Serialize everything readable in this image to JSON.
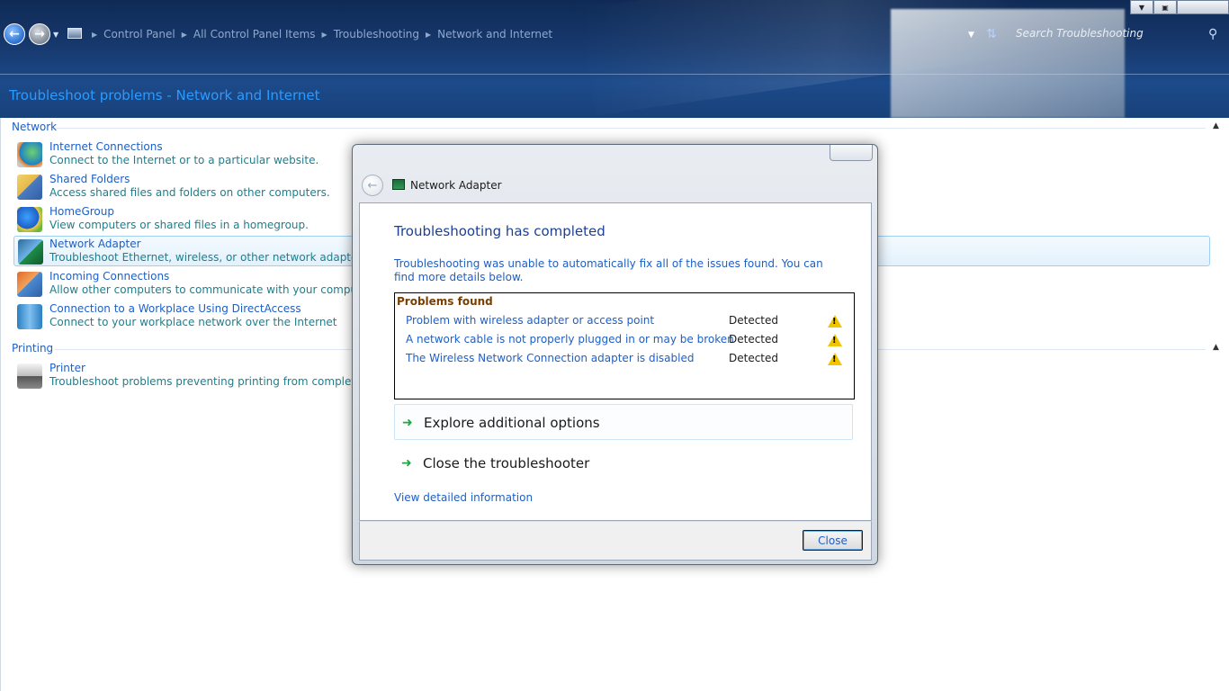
{
  "window": {
    "breadcrumb": [
      "Control Panel",
      "All Control Panel Items",
      "Troubleshooting",
      "Network and Internet"
    ],
    "search_placeholder": "Search Troubleshooting",
    "page_title": "Troubleshoot problems - Network and Internet"
  },
  "groups": {
    "network": {
      "label": "Network",
      "items": [
        {
          "title": "Internet Connections",
          "desc": "Connect to the Internet or to a particular website."
        },
        {
          "title": "Shared Folders",
          "desc": "Access shared files and folders on other computers."
        },
        {
          "title": "HomeGroup",
          "desc": "View computers or shared files in a homegroup."
        },
        {
          "title": "Network Adapter",
          "desc": "Troubleshoot Ethernet, wireless, or other network adapters."
        },
        {
          "title": "Incoming Connections",
          "desc": "Allow other computers to communicate with your computer thr"
        },
        {
          "title": "Connection to a Workplace Using DirectAccess",
          "desc": "Connect to your workplace network over the Internet"
        }
      ]
    },
    "printing": {
      "label": "Printing",
      "items": [
        {
          "title": "Printer",
          "desc": "Troubleshoot problems preventing printing from completing."
        }
      ]
    }
  },
  "dialog": {
    "title": "Network Adapter",
    "heading": "Troubleshooting has completed",
    "intro": "Troubleshooting was unable to automatically fix all of the issues found. You can find more details below.",
    "problems_title": "Problems found",
    "problems": [
      {
        "name": "Problem with wireless adapter or access point",
        "status": "Detected"
      },
      {
        "name": "A network cable is not properly plugged in or may be broken",
        "status": "Detected"
      },
      {
        "name": "The Wireless Network Connection adapter is disabled",
        "status": "Detected"
      }
    ],
    "options": {
      "explore": "Explore additional options",
      "close_troubleshooter": "Close the troubleshooter"
    },
    "details_link": "View detailed information",
    "close_button": "Close"
  },
  "colors": {
    "link": "#1e5fc6",
    "desc": "#1c7f8c",
    "heading": "#1c3f94",
    "warning": "#f0c400",
    "arrow": "#1fa544"
  },
  "icons": {
    "back": "back-arrow-icon",
    "forward": "forward-arrow-icon",
    "search": "search-icon",
    "refresh": "refresh-icon",
    "warning": "warning-icon"
  }
}
